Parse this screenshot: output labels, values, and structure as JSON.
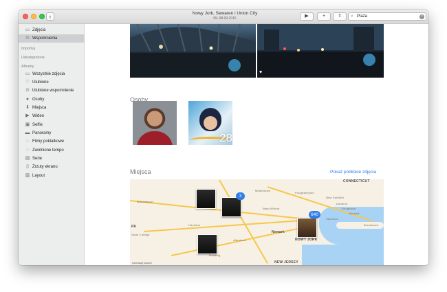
{
  "window": {
    "title": "Nowy Jork, Sewaren i Union City",
    "subtitle": "05–08.09.2016"
  },
  "toolbar": {
    "back_glyph": "‹",
    "play_glyph": "▶",
    "add_glyph": "+",
    "share_glyph": "⇧",
    "search_value": "Plaża"
  },
  "sidebar": {
    "items_top": [
      {
        "label": "Zdjęcia",
        "icon": "photos-icon",
        "glyph": "▭"
      },
      {
        "label": "Wspomnienia",
        "icon": "memories-icon",
        "glyph": "⊙",
        "selected": true
      }
    ],
    "headers": {
      "imports": "Importuj",
      "shared": "Udostępnione",
      "albums": "Albumy"
    },
    "albums": [
      {
        "label": "Wszystkie zdjęcia",
        "icon": "all-photos-icon",
        "glyph": "▭"
      },
      {
        "label": "Ulubione",
        "icon": "heart-icon",
        "glyph": "♡"
      },
      {
        "label": "Ulubione wspomnienie",
        "icon": "favorite-memory-icon",
        "glyph": "⊙"
      },
      {
        "label": "Osoby",
        "icon": "people-icon",
        "glyph": "●"
      },
      {
        "label": "Miejsca",
        "icon": "pin-icon",
        "glyph": "⬇"
      },
      {
        "label": "Wideo",
        "icon": "video-icon",
        "glyph": "▶"
      },
      {
        "label": "Selfie",
        "icon": "selfie-icon",
        "glyph": "▣"
      },
      {
        "label": "Panoramy",
        "icon": "panorama-icon",
        "glyph": "▬"
      },
      {
        "label": "Filmy poklatkowe",
        "icon": "timelapse-icon",
        "glyph": "◌"
      },
      {
        "label": "Zwolnione tempo",
        "icon": "slowmo-icon",
        "glyph": "◌"
      },
      {
        "label": "Serie",
        "icon": "burst-icon",
        "glyph": "▤"
      },
      {
        "label": "Zrzuty ekranu",
        "icon": "screenshot-icon",
        "glyph": "▯"
      },
      {
        "label": "Layout",
        "icon": "layout-icon",
        "glyph": "▥"
      }
    ]
  },
  "main": {
    "people_title": "Osoby",
    "person_count": "28",
    "places_title": "Miejsca",
    "show_nearby": "Pokaż pobliskie zdjęcia",
    "map": {
      "labels": [
        "CONNECTICUT",
        "Middletown",
        "Poughkeepsie",
        "New Fairfield",
        "Danbury",
        "Norwalk",
        "Bridgeport",
        "Stamford",
        "Williamsport",
        "West Milford",
        "Newark",
        "NOWY JORK",
        "NEW JERSEY",
        "Allentown",
        "Reading",
        "Hazleton",
        "PA",
        "State College",
        "Danbury",
        "Brentwood"
      ],
      "badges": [
        "3",
        "640"
      ],
      "legal": "Informacje prawne"
    }
  }
}
